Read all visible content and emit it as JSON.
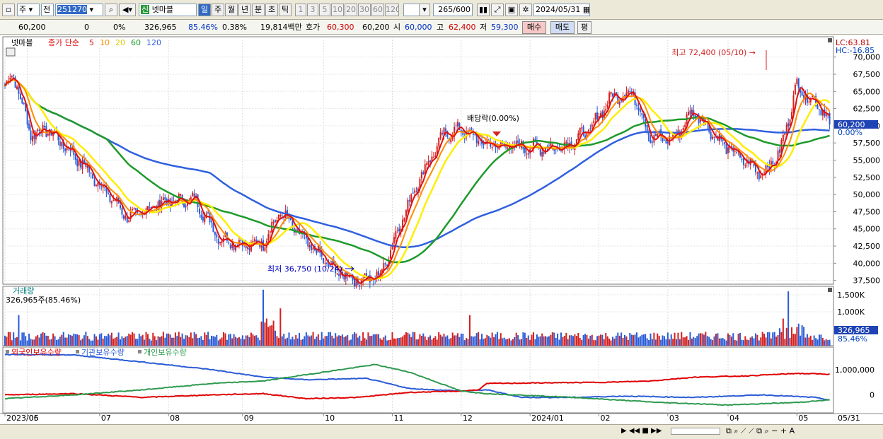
{
  "toolbar": {
    "market": "주",
    "market2": "전",
    "code": "251270",
    "stock_tag": "신",
    "stock_name": "넷마블",
    "periods": [
      "일",
      "주",
      "월",
      "년",
      "분",
      "초",
      "틱"
    ],
    "active_period": "일",
    "intervals": [
      "1",
      "3",
      "5",
      "10",
      "20",
      "30",
      "60",
      "120"
    ],
    "count": "265",
    "count_total": "/600",
    "date": "2024/05/31"
  },
  "info": {
    "price": "60,200",
    "change": "0",
    "change_pct": "0%",
    "volume": "326,965",
    "vol_ratio": "85.46%",
    "turnover": "0.38%",
    "amount": "19,814백만",
    "hoga_label": "호가",
    "ask": "60,300",
    "bid": "60,200",
    "open_label": "시",
    "open": "60,000",
    "high_label": "고",
    "high": "62,400",
    "low_label": "저",
    "low": "59,300",
    "buy_label": "매수",
    "sell_label": "매도",
    "flat_label": "평"
  },
  "price_panel": {
    "title": "넷마블",
    "ma_label": "종가 단순",
    "ma_periods": [
      "5",
      "10",
      "20",
      "60",
      "120"
    ],
    "lc": "LC:63.81",
    "hc": "HC:-16.85",
    "max_note": "최고 72,400 (05/10)",
    "min_note": "최저 36,750 (10/24)",
    "div_note": "배당락(0.00%)",
    "y_ticks": [
      "70,000",
      "67,500",
      "65,000",
      "62,500",
      "60,000",
      "57,500",
      "55,000",
      "52,500",
      "50,000",
      "47,500",
      "45,000",
      "42,500",
      "40,000",
      "37,500"
    ],
    "current_tag": "60,200",
    "current_pct": "0.00%"
  },
  "volume_panel": {
    "title": "거래량",
    "subtitle": "326,965주(85.46%)",
    "y_ticks": [
      "1,500K",
      "1,000K"
    ],
    "current_tag": "326,965",
    "current_pct": "85.46%"
  },
  "holding_panel": {
    "series": [
      "외국인보유수량",
      "기관보유수량",
      "개인보유수량"
    ],
    "y_ticks": [
      "1,000,000",
      "0"
    ]
  },
  "x_axis": {
    "labels": [
      "2023/05",
      "06",
      "07",
      "08",
      "09",
      "10",
      "11",
      "12",
      "2024/01",
      "02",
      "03",
      "04",
      "05"
    ],
    "right_label": "05/31"
  },
  "colors": {
    "up": "#d42020",
    "down": "#2a5bd7",
    "ma5": "#e01010",
    "ma10": "#ff8c00",
    "ma20": "#ffee00",
    "ma60": "#1e9a2a",
    "ma120": "#3060e0",
    "foreign": "#e00000",
    "inst": "#2a5bd7",
    "indiv": "#2e9a50"
  },
  "chart_data": {
    "type": "candlestick",
    "months": [
      "2023/05",
      "06",
      "07",
      "08",
      "09",
      "10",
      "11",
      "12",
      "2024/01",
      "02",
      "03",
      "04",
      "05"
    ],
    "close_anchors": [
      [
        0,
        65800
      ],
      [
        5,
        67500
      ],
      [
        15,
        58800
      ],
      [
        25,
        59500
      ],
      [
        40,
        55800
      ],
      [
        55,
        51500
      ],
      [
        72,
        46500
      ],
      [
        90,
        48800
      ],
      [
        110,
        49300
      ],
      [
        125,
        43600
      ],
      [
        140,
        42600
      ],
      [
        150,
        43000
      ],
      [
        160,
        47500
      ],
      [
        175,
        43000
      ],
      [
        192,
        38800
      ],
      [
        205,
        37500
      ],
      [
        218,
        38200
      ],
      [
        230,
        46000
      ],
      [
        240,
        52000
      ],
      [
        255,
        58800
      ],
      [
        265,
        59500
      ],
      [
        280,
        57200
      ],
      [
        295,
        57000
      ],
      [
        310,
        56800
      ],
      [
        325,
        57000
      ],
      [
        340,
        59500
      ],
      [
        352,
        64200
      ],
      [
        365,
        64800
      ],
      [
        375,
        58200
      ],
      [
        388,
        58100
      ],
      [
        400,
        62200
      ],
      [
        415,
        57800
      ],
      [
        430,
        54800
      ],
      [
        440,
        53000
      ],
      [
        450,
        56000
      ],
      [
        460,
        66000
      ],
      [
        465,
        64500
      ],
      [
        475,
        62500
      ],
      [
        479,
        60200
      ]
    ],
    "volume_spikes": [
      [
        "2023/05 early",
        900000
      ],
      [
        "2023/09 mid",
        1650000
      ],
      [
        "2023/12 mid",
        900000
      ],
      [
        "2024/05 early",
        1600000
      ]
    ]
  }
}
